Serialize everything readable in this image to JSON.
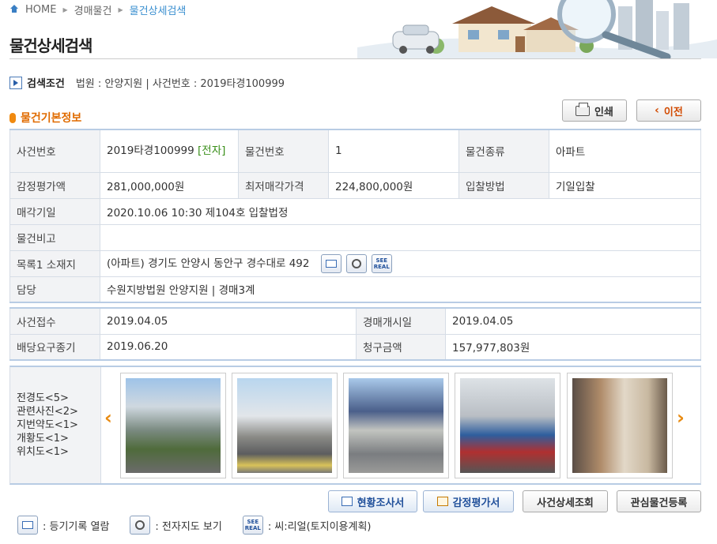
{
  "breadcrumb": {
    "home": "HOME",
    "level1": "경매물건",
    "level2": "물건상세검색"
  },
  "page_title": "물건상세검색",
  "search": {
    "label": "검색조건",
    "text": "법원 : 안양지원 | 사건번호 : 2019타경100999"
  },
  "section_title": "물건기본정보",
  "buttons": {
    "print": "인쇄",
    "back": "이전"
  },
  "basic": {
    "case_no_label": "사건번호",
    "case_no": "2019타경100999",
    "case_no_tag": "[전자]",
    "item_no_label": "물건번호",
    "item_no": "1",
    "item_type_label": "물건종류",
    "item_type": "아파트",
    "appraisal_label": "감정평가액",
    "appraisal": "281,000,000원",
    "min_price_label": "최저매각가격",
    "min_price": "224,800,000원",
    "bid_method_label": "입찰방법",
    "bid_method": "기일입찰",
    "sale_date_label": "매각기일",
    "sale_date": "2020.10.06 10:30 제104호 입찰법정",
    "remark_label": "물건비고",
    "remark": "",
    "location_label": "목록1 소재지",
    "location": "(아파트) 경기도 안양시 동안구 경수대로 492",
    "charge_label": "담당",
    "charge": "수원지방법원 안양지원 | 경매3계"
  },
  "icons": {
    "register": "register-doc-icon",
    "map": "map-icon",
    "real": "SEE REAL"
  },
  "dates": {
    "received_label": "사건접수",
    "received": "2019.04.05",
    "start_label": "경매개시일",
    "start": "2019.04.05",
    "dividend_label": "배당요구종기",
    "dividend": "2019.06.20",
    "claim_label": "청구금액",
    "claim": "157,977,803원"
  },
  "photo_types": [
    "전경도<5>",
    "관련사진<2>",
    "지번약도<1>",
    "개황도<1>",
    "위치도<1>"
  ],
  "actions": {
    "survey": "현황조사서",
    "appraisal": "감정평가서",
    "case_detail": "사건상세조회",
    "interest": "관심물건등록"
  },
  "legend": {
    "register": ": 등기기록 열람",
    "map": ": 전자지도 보기",
    "real": ": 씨:리얼(토지이용계획)"
  }
}
